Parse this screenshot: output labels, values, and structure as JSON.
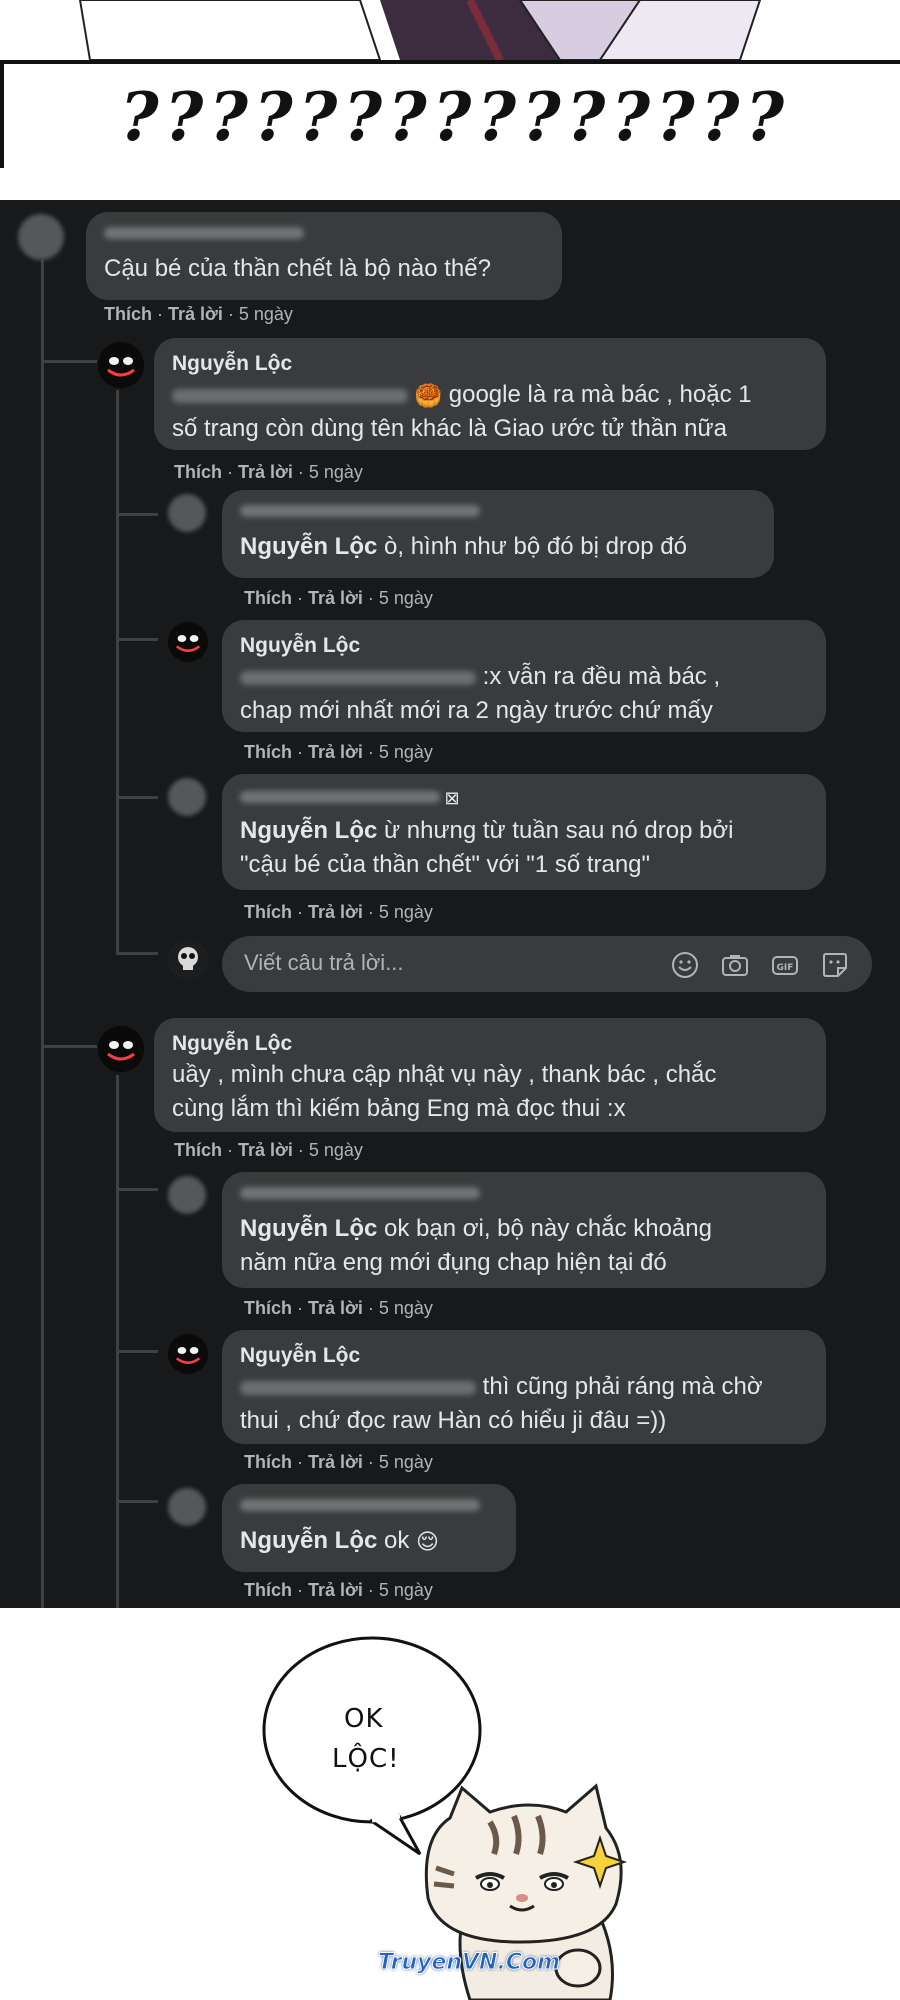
{
  "top": {
    "question_marks": "???????????????"
  },
  "comments": {
    "root": {
      "text": "Cậu bé của thần chết là bộ nào thế?",
      "like": "Thích",
      "reply": "Trả lời",
      "time": "5 ngày"
    },
    "r1": {
      "author": "Nguyễn Lộc",
      "text_line1": "google là ra mà bác , hoặc 1",
      "text_line2": "số trang còn dùng tên khác là Giao ước tử thần nữa",
      "like": "Thích",
      "reply": "Trả lời",
      "time": "5 ngày"
    },
    "r1a": {
      "mention": "Nguyễn Lộc",
      "text": "ò, hình như bộ đó bị drop đó",
      "like": "Thích",
      "reply": "Trả lời",
      "time": "5 ngày"
    },
    "r1b": {
      "author": "Nguyễn Lộc",
      "text_line1": ":x vẫn ra đều mà bác ,",
      "text_line2": "chap mới nhất mới ra 2 ngày trước chứ mấy",
      "like": "Thích",
      "reply": "Trả lời",
      "time": "5 ngày"
    },
    "r1c": {
      "mention": "Nguyễn Lộc",
      "text_line1": "ừ nhưng từ tuần sau nó drop bởi",
      "text_line2": "\"cậu bé của thần chết\" với \"1 số trang\"",
      "like": "Thích",
      "reply": "Trả lời",
      "time": "5 ngày"
    },
    "reply_input": {
      "placeholder": "Viết câu trả lời..."
    },
    "r2": {
      "author": "Nguyễn Lộc",
      "text_line1": "uầy , mình chưa cập nhật vụ này , thank bác , chắc",
      "text_line2": "cùng lắm thì kiếm bảng Eng mà đọc thui :x",
      "like": "Thích",
      "reply": "Trả lời",
      "time": "5 ngày"
    },
    "r2a": {
      "mention": "Nguyễn Lộc",
      "text_line1": "ok bạn ơi, bộ này chắc khoảng",
      "text_line2": "năm nữa eng mới đụng chap hiện tại đó",
      "like": "Thích",
      "reply": "Trả lời",
      "time": "5 ngày"
    },
    "r2b": {
      "author": "Nguyễn Lộc",
      "text_line1": "thì cũng phải ráng mà chờ",
      "text_line2": "thui , chứ đọc raw Hàn có hiểu ji đâu =))",
      "like": "Thích",
      "reply": "Trả lời",
      "time": "5 ngày"
    },
    "r2c": {
      "mention": "Nguyễn Lộc",
      "text": "ok",
      "like": "Thích",
      "reply": "Trả lời",
      "time": "5 ngày"
    }
  },
  "sticker": {
    "speech_line1": "OK",
    "speech_line2": "LỘC!",
    "watermark": "TruyenVN.Com"
  },
  "colors": {
    "panel_bg": "#18191a",
    "bubble_bg": "#3a3b3c",
    "text_primary": "#e4e6eb",
    "text_secondary": "#b0b3b8"
  }
}
